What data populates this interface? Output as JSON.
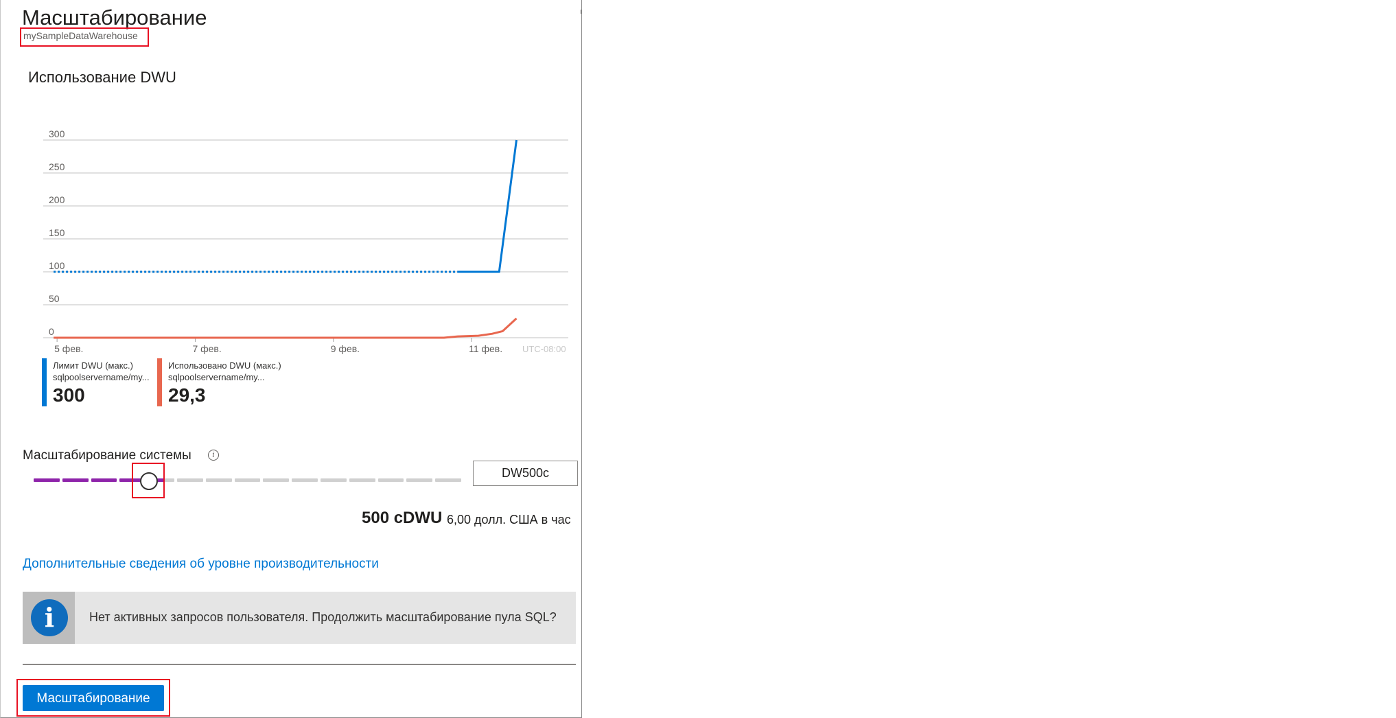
{
  "panel": {
    "title": "Масштабирование",
    "subtitle": "mySampleDataWarehouse"
  },
  "chart": {
    "title": "Использование DWU",
    "timezone": "UTC-08:00"
  },
  "chart_data": {
    "type": "line",
    "title": "Использование DWU",
    "xlabel": "",
    "ylabel": "",
    "ylim": [
      0,
      300
    ],
    "yticks": [
      "300",
      "250",
      "200",
      "150",
      "100",
      "50",
      "0"
    ],
    "xticks": [
      "5 фев.",
      "7 фев.",
      "9 фев.",
      "11 фев."
    ],
    "grid": true,
    "series": [
      {
        "name": "Лимит DWU (макс.)",
        "color": "#0078d4",
        "segments": [
          {
            "style": "dotted",
            "x": [
              4.95,
              10.8
            ],
            "y": [
              100,
              100
            ]
          },
          {
            "style": "solid",
            "x": [
              10.8,
              11.4,
              11.65
            ],
            "y": [
              100,
              100,
              300
            ]
          }
        ]
      },
      {
        "name": "Использовано DWU (макс.)",
        "color": "#e8674f",
        "segments": [
          {
            "style": "solid",
            "x": [
              4.95,
              10.6,
              10.8,
              11.1,
              11.3,
              11.45,
              11.65
            ],
            "y": [
              0,
              0,
              2,
              3,
              6,
              10,
              29.3
            ]
          }
        ]
      }
    ]
  },
  "legend": [
    {
      "name": "Лимит DWU (макс.)",
      "source": "sqlpoolservername/my...",
      "value": "300",
      "color": "#0078d4"
    },
    {
      "name": "Использовано DWU (макс.)",
      "source": "sqlpoolservername/my...",
      "value": "29,3",
      "color": "#e8674f"
    }
  ],
  "scale": {
    "label": "Масштабирование системы",
    "info_icon": "info-circle-icon",
    "selected_tier": "DW500c",
    "slider_steps_total": 15,
    "slider_selected_step": 5,
    "cdwu_value": "500 cDWU",
    "price": "6,00 долл. США в час"
  },
  "link": {
    "label": "Дополнительные сведения об уровне производительности"
  },
  "info_banner": {
    "icon": "info-icon",
    "text": "Нет активных запросов пользователя. Продолжить масштабирование пула SQL?"
  },
  "actions": {
    "scale_button": "Масштабирование"
  },
  "colors": {
    "accent": "#0078d4",
    "slider_active": "#8e24aa",
    "slider_inactive": "#d0d0d0",
    "highlight": "#e81123"
  }
}
